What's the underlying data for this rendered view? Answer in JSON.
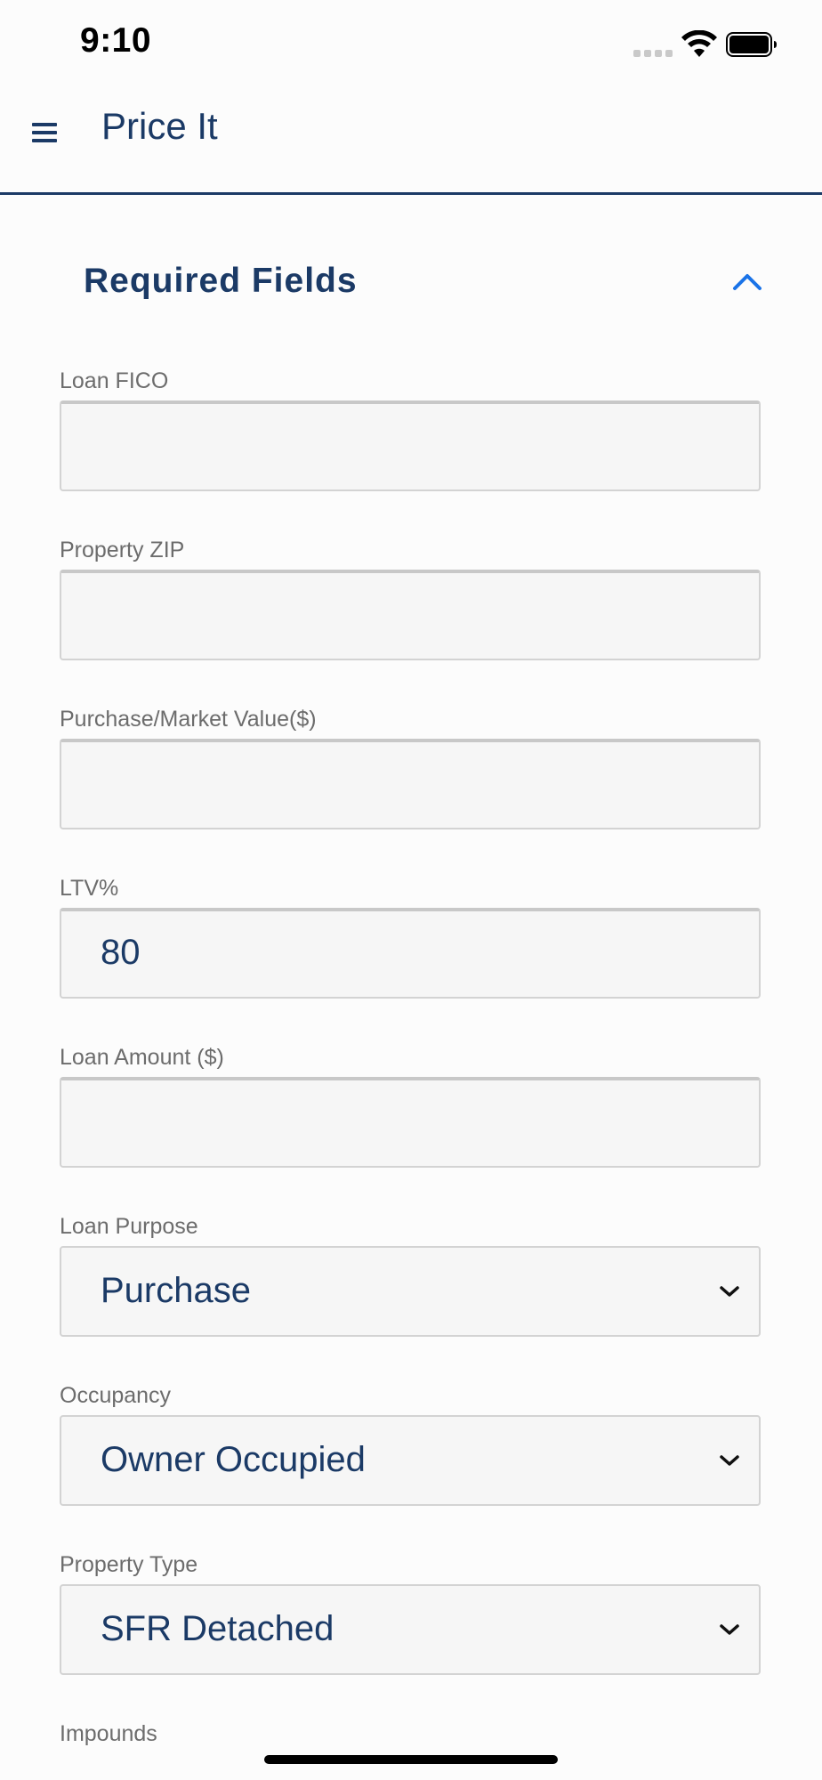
{
  "status_bar": {
    "time": "9:10"
  },
  "header": {
    "title": "Price It",
    "menu_icon": "hamburger-menu-icon"
  },
  "section": {
    "title": "Required Fields",
    "toggle_icon": "chevron-up-icon"
  },
  "fields": {
    "loan_fico": {
      "label": "Loan FICO",
      "value": ""
    },
    "property_zip": {
      "label": "Property ZIP",
      "value": ""
    },
    "purchase_value": {
      "label": "Purchase/Market Value($)",
      "value": ""
    },
    "ltv": {
      "label": "LTV%",
      "value": "80"
    },
    "loan_amount": {
      "label": "Loan Amount ($)",
      "value": ""
    },
    "loan_purpose": {
      "label": "Loan Purpose",
      "value": "Purchase"
    },
    "occupancy": {
      "label": "Occupancy",
      "value": "Owner Occupied"
    },
    "property_type": {
      "label": "Property Type",
      "value": "SFR Detached"
    },
    "impounds": {
      "label": "Impounds"
    }
  },
  "colors": {
    "primary": "#1b3a66",
    "accent": "#1a73e8",
    "label": "#6c6c6c",
    "field_bg": "#f6f6f6",
    "border": "#d3d3d3"
  }
}
